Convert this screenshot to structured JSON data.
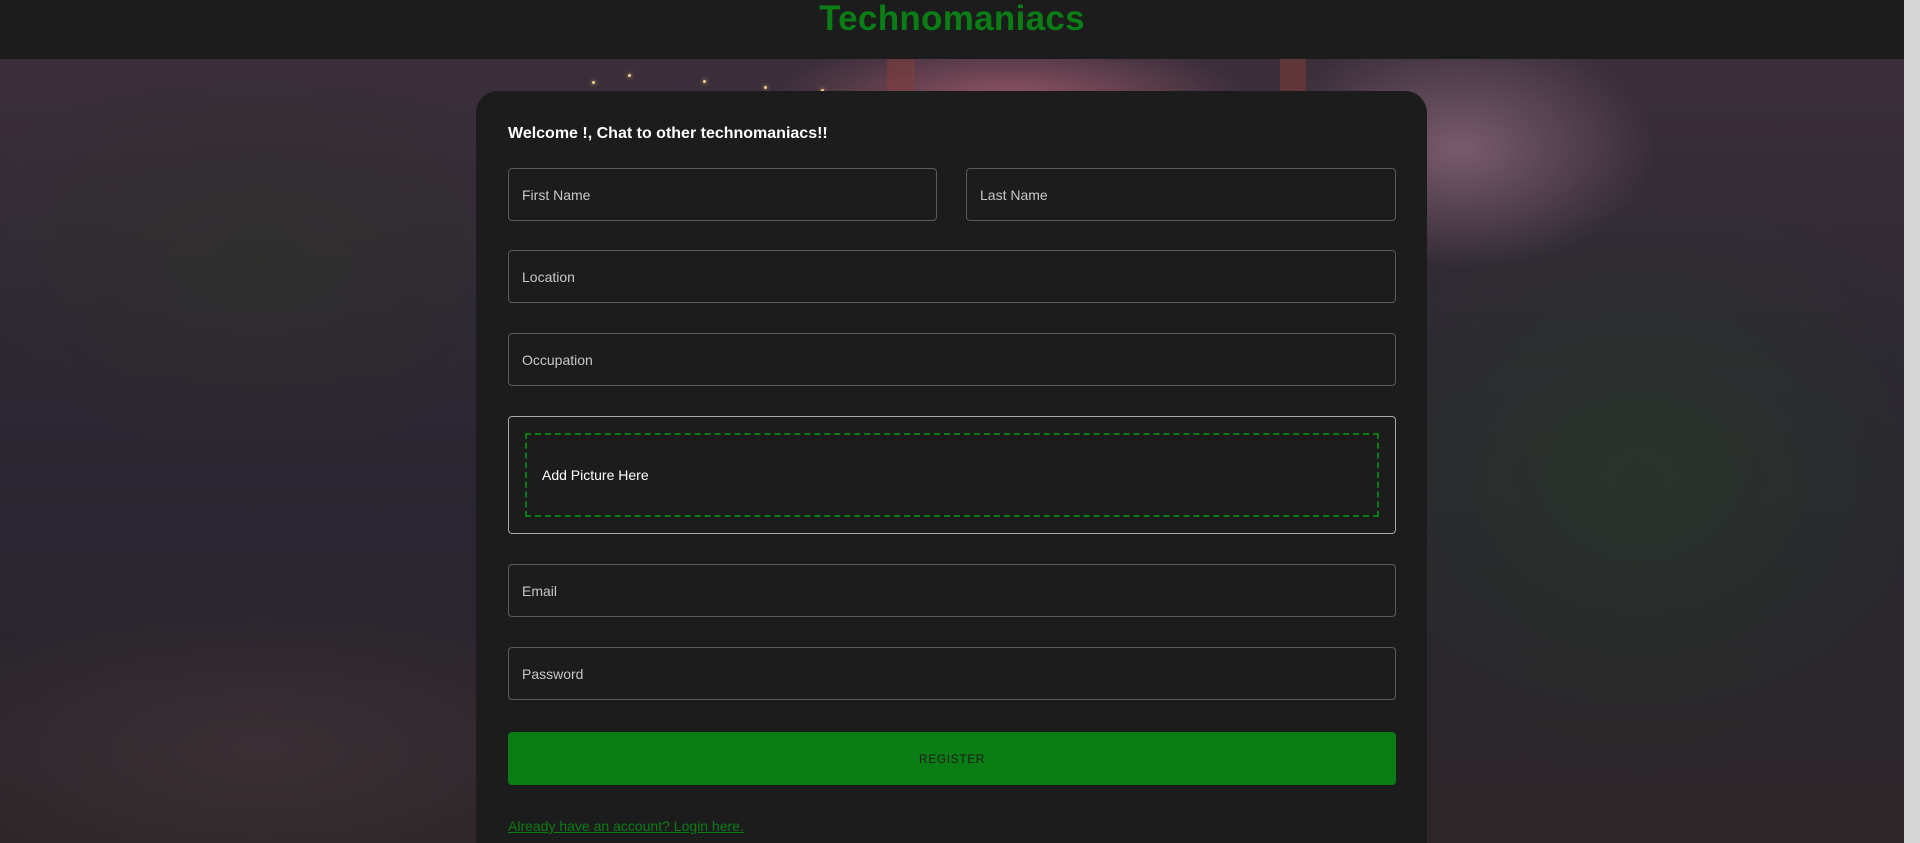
{
  "header": {
    "brand": "Technomaniacs"
  },
  "form": {
    "welcome": "Welcome !, Chat to other technomaniacs!!",
    "first_name": {
      "placeholder": "First Name",
      "value": ""
    },
    "last_name": {
      "placeholder": "Last Name",
      "value": ""
    },
    "location": {
      "placeholder": "Location",
      "value": ""
    },
    "occupation": {
      "placeholder": "Occupation",
      "value": ""
    },
    "picture": {
      "label": "Add Picture Here"
    },
    "email": {
      "placeholder": "Email",
      "value": ""
    },
    "password": {
      "placeholder": "Password",
      "value": ""
    },
    "register_label": "REGISTER",
    "login_link": "Already have an account? Login here."
  },
  "colors": {
    "accent": "#0a7e14",
    "card_background": "#1c1c1c",
    "header_background": "#1c1c1c",
    "field_border": "#5b5b5b"
  },
  "icons": []
}
